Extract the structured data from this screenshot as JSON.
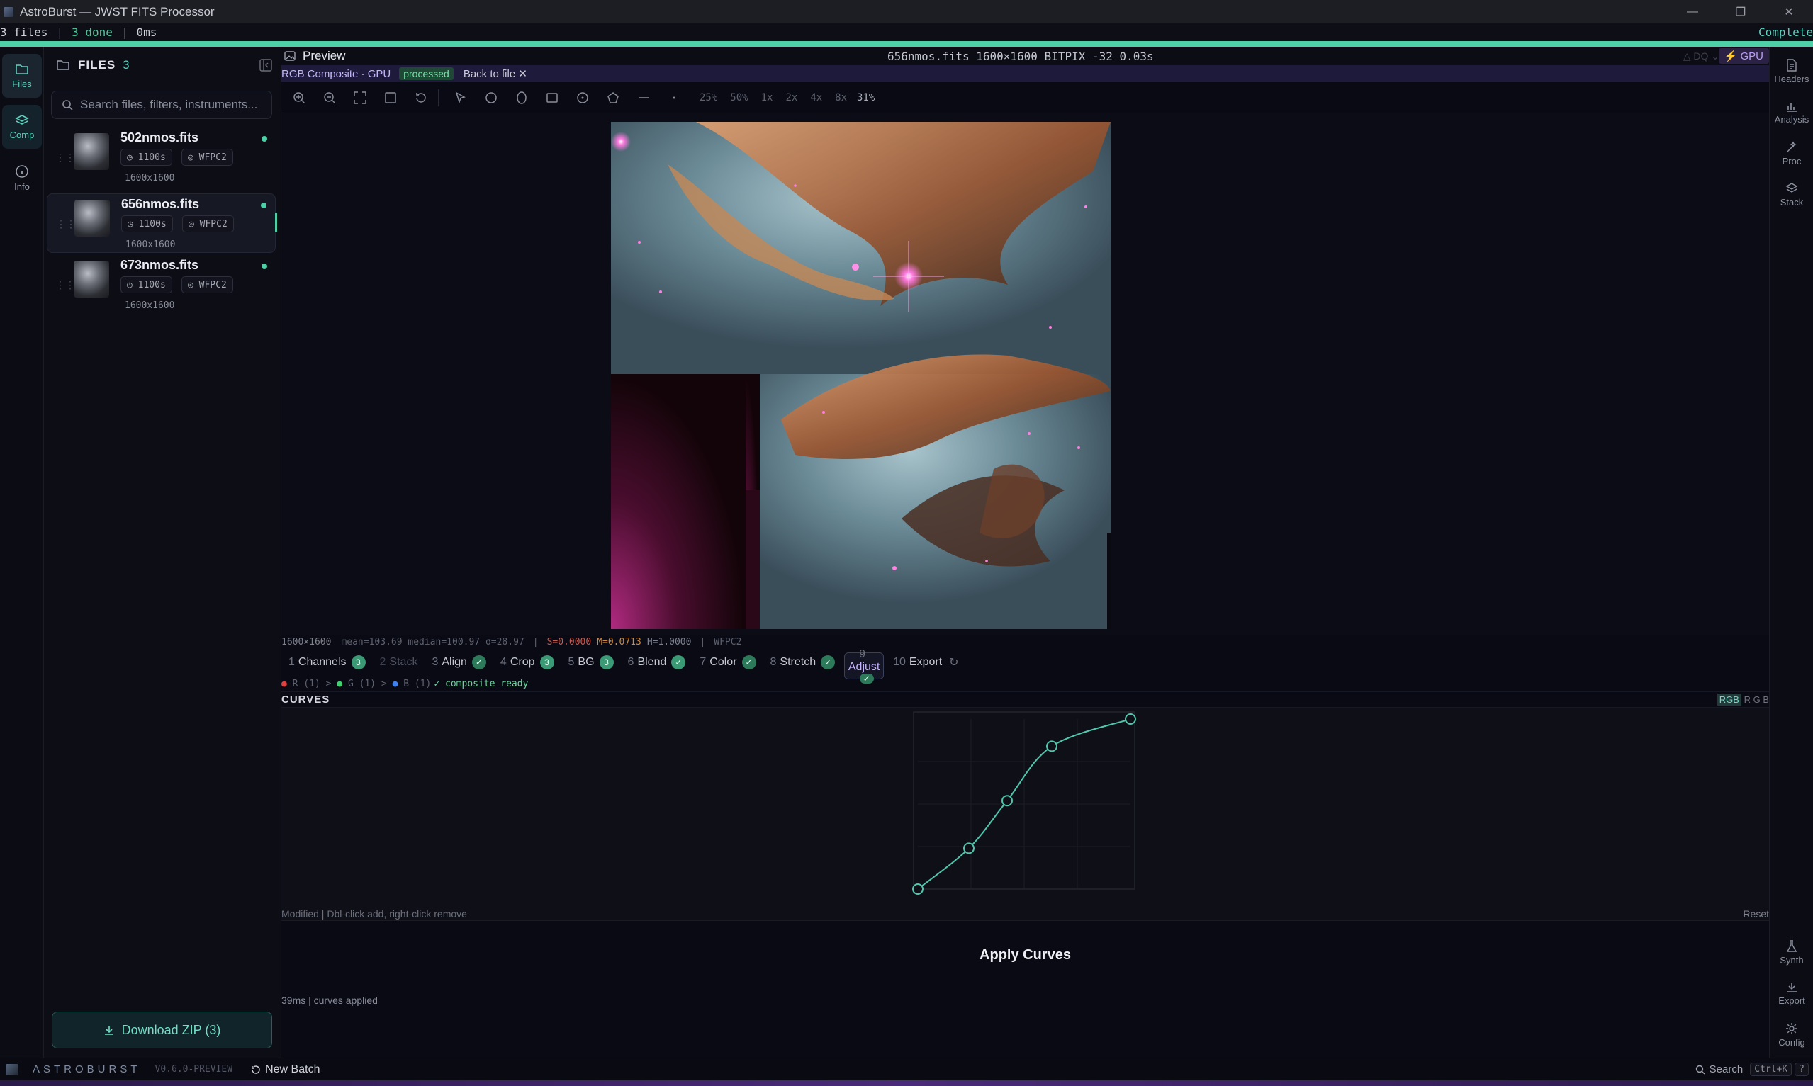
{
  "window": {
    "title": "AstroBurst — JWST FITS Processor"
  },
  "status": {
    "files": "3 files",
    "done": "3 done",
    "time": "0ms",
    "state": "Complete"
  },
  "activity": [
    {
      "label": "Files",
      "icon": "folder-icon"
    },
    {
      "label": "Comp",
      "icon": "layers-icon"
    },
    {
      "label": "Info",
      "icon": "info-icon"
    }
  ],
  "files_panel": {
    "title": "FILES",
    "count": "3",
    "search_placeholder": "Search files, filters, instruments...",
    "files": [
      {
        "name": "502nmos.fits",
        "exposure": "1100s",
        "instrument": "WFPC2",
        "dims": "1600x1600",
        "selected": false
      },
      {
        "name": "656nmos.fits",
        "exposure": "1100s",
        "instrument": "WFPC2",
        "dims": "1600x1600",
        "selected": true
      },
      {
        "name": "673nmos.fits",
        "exposure": "1100s",
        "instrument": "WFPC2",
        "dims": "1600x1600",
        "selected": false
      }
    ],
    "download_label": "Download ZIP (3)"
  },
  "preview": {
    "title": "Preview",
    "file_info": "656nmos.fits  1600×1600  BITPIX -32  0.03s",
    "dq_label": "DQ",
    "gpu_label": "GPU",
    "composite_label": "RGB Composite · GPU",
    "processed_badge": "processed",
    "back_label": "Back to file",
    "zoom_levels": [
      "25%",
      "50%",
      "1x",
      "2x",
      "4x",
      "8x"
    ],
    "zoom_current": "31%",
    "stats": {
      "dims": "1600×1600",
      "basic": "mean=103.69  median=100.97  σ=28.97",
      "s": "S=0.0000",
      "m": "M=0.0713",
      "h": "H=1.0000",
      "instrument": "WFPC2"
    }
  },
  "pipeline": {
    "steps": [
      {
        "num": "1",
        "label": "Channels",
        "badge": "3",
        "state": "count"
      },
      {
        "num": "2",
        "label": "Stack",
        "badge": "",
        "state": "dim"
      },
      {
        "num": "3",
        "label": "Align",
        "badge": "✓",
        "state": "done"
      },
      {
        "num": "4",
        "label": "Crop",
        "badge": "3",
        "state": "count"
      },
      {
        "num": "5",
        "label": "BG",
        "badge": "3",
        "state": "count"
      },
      {
        "num": "6",
        "label": "Blend",
        "badge": "✓",
        "state": "done"
      },
      {
        "num": "7",
        "label": "Color",
        "badge": "✓",
        "state": "done"
      },
      {
        "num": "8",
        "label": "Stretch",
        "badge": "✓",
        "state": "done"
      },
      {
        "num": "9",
        "label": "Adjust",
        "badge": "✓",
        "state": "active"
      },
      {
        "num": "10",
        "label": "Export",
        "badge": "",
        "state": "plain"
      }
    ],
    "channels_line": {
      "r": "R (1)",
      "g": "G (1)",
      "b": "B (1)",
      "ready": "✓ composite ready"
    }
  },
  "curves": {
    "title": "CURVES",
    "channels": [
      "RGB",
      "R",
      "G",
      "B"
    ],
    "active_channel": "RGB",
    "points": [
      [
        0,
        0
      ],
      [
        0.24,
        0.24
      ],
      [
        0.42,
        0.52
      ],
      [
        0.63,
        0.84
      ],
      [
        1,
        1
      ]
    ],
    "footer_note": "Modified | Dbl-click add, right-click remove",
    "reset_label": "Reset",
    "apply_label": "Apply Curves",
    "timing": "39ms | curves applied",
    "curve_color": "#4fc7ad"
  },
  "right_panel": [
    {
      "label": "Headers",
      "icon": "document-icon"
    },
    {
      "label": "Analysis",
      "icon": "chart-icon"
    },
    {
      "label": "Proc",
      "icon": "magic-icon"
    },
    {
      "label": "Stack",
      "icon": "stack-icon"
    },
    {
      "label": "Synth",
      "icon": "flask-icon"
    },
    {
      "label": "Export",
      "icon": "download-icon"
    },
    {
      "label": "Config",
      "icon": "gear-icon"
    }
  ],
  "footer": {
    "brand": "ASTROBURST",
    "version": "V0.6.0-PREVIEW",
    "new_batch": "New Batch",
    "search_label": "Search",
    "shortcut": "Ctrl+K",
    "help": "?"
  },
  "colors": {
    "accent": "#4dd0a6",
    "gpu": "#b89cf5",
    "composite_bar": "#1e1a3c"
  }
}
